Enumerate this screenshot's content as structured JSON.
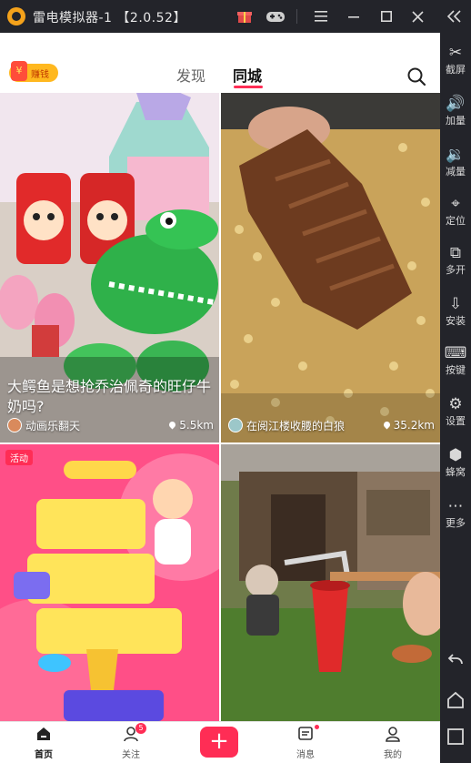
{
  "window": {
    "title": "雷电模拟器-1 【2.0.52】",
    "accent": "#f4a21b"
  },
  "sidebar": {
    "collapse_icon": "double-chevron-left-icon",
    "items": [
      {
        "icon": "scissors-icon",
        "label": "截屏"
      },
      {
        "icon": "volume-up-icon",
        "label": "加量"
      },
      {
        "icon": "volume-down-icon",
        "label": "减量"
      },
      {
        "icon": "location-icon",
        "label": "定位"
      },
      {
        "icon": "multi-window-icon",
        "label": "多开"
      },
      {
        "icon": "apk-install-icon",
        "label": "安装"
      },
      {
        "icon": "keyboard-icon",
        "label": "按键"
      },
      {
        "icon": "gear-icon",
        "label": "设置"
      },
      {
        "icon": "beehive-icon",
        "label": "蜂窝"
      },
      {
        "icon": "more-icon",
        "label": "更多"
      }
    ],
    "nav": [
      "back-icon",
      "home-icon",
      "recents-icon"
    ]
  },
  "app": {
    "badge_text": "赚钱",
    "tabs": [
      {
        "label": "发现",
        "active": false
      },
      {
        "label": "同城",
        "active": true
      }
    ],
    "accent": "#ff2d55"
  },
  "feed": [
    {
      "title": "大鳄鱼是想抢乔治佩奇的旺仔牛奶吗?",
      "user": "动画乐翻天",
      "distance": "5.5km"
    },
    {
      "title": "",
      "user": "在阅江楼收腰的白狼",
      "distance": "35.2km"
    },
    {
      "tag": "活动"
    },
    {}
  ],
  "bottom_nav": [
    {
      "label": "首页",
      "icon": "home-icon",
      "active": true
    },
    {
      "label": "关注",
      "icon": "follow-icon",
      "badge": "5"
    },
    {
      "label": "",
      "icon": "plus-icon"
    },
    {
      "label": "消息",
      "icon": "message-icon",
      "dot": true
    },
    {
      "label": "我的",
      "icon": "profile-icon"
    }
  ]
}
